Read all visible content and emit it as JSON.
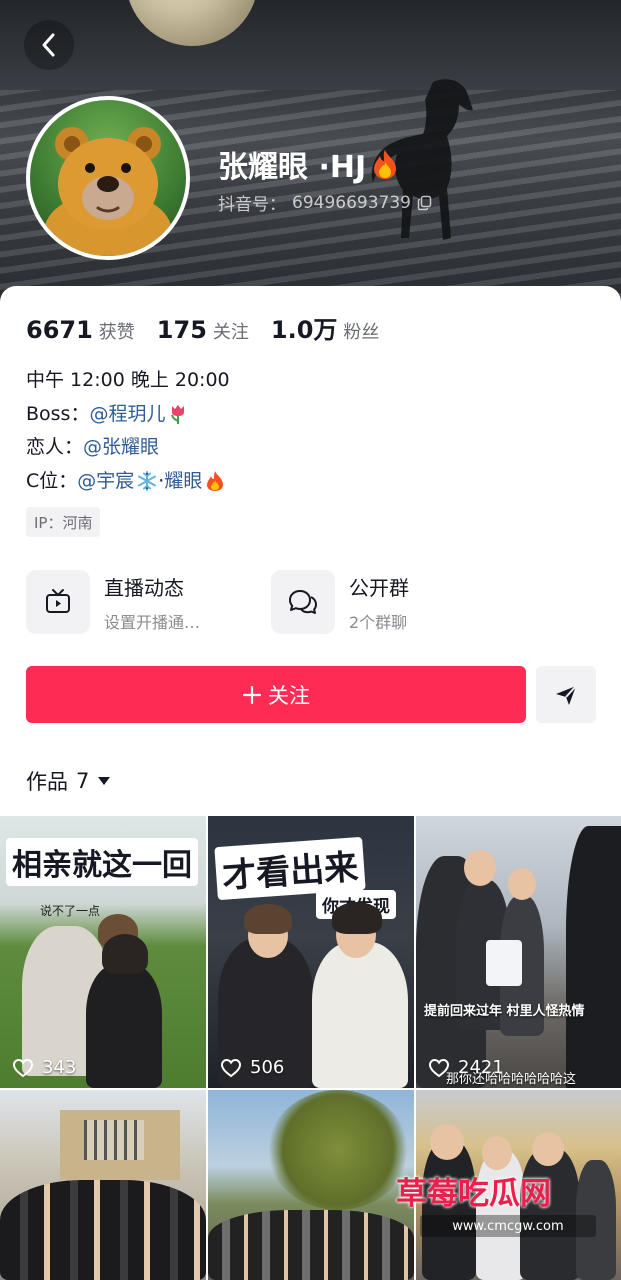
{
  "profile": {
    "nickname": "张耀眼 ·HJ",
    "douyin_id_label": "抖音号：",
    "douyin_id": "69496693739"
  },
  "stats": [
    {
      "value": "6671",
      "label": "获赞"
    },
    {
      "value": "175",
      "label": "关注"
    },
    {
      "value": "1.0万",
      "label": "粉丝"
    }
  ],
  "bio": {
    "line1": "中午 12:00 晚上 20:00",
    "line2_prefix": "Boss：",
    "line2_mention": "@程玥儿",
    "line3_prefix": "恋人：",
    "line3_mention": "@张耀眼",
    "line4_prefix": "C位：",
    "line4_mention": "@宇宸",
    "line4_sep": "·",
    "line4_mention2": "耀眼"
  },
  "ip_tag": "IP：河南",
  "features": [
    {
      "title": "直播动态",
      "subtitle": "设置开播通…",
      "icon": "tv-icon"
    },
    {
      "title": "公开群",
      "subtitle": "2个群聊",
      "icon": "group-chat-icon"
    }
  ],
  "follow_button": {
    "label": "关注"
  },
  "works_tab": {
    "label": "作品",
    "count": "7"
  },
  "videos": [
    {
      "likes": "343",
      "caption": "相亲就这一回",
      "subcaption": "说不了一点"
    },
    {
      "likes": "506",
      "caption": "才看出来",
      "subcaption": "你才发现"
    },
    {
      "likes": "2421",
      "caption": "提前回来过年 村里人怪热情",
      "subcaption": "那你还哈哈哈哈哈哈这"
    },
    {
      "likes": "",
      "caption": "",
      "subcaption": ""
    },
    {
      "likes": "",
      "caption": "",
      "subcaption": ""
    },
    {
      "likes": "",
      "caption": "",
      "subcaption": ""
    }
  ],
  "watermark": {
    "text": "草莓吃瓜网",
    "url": "www.cmcgw.com"
  },
  "colors": {
    "accent": "#fe2c55",
    "mention": "#2f5c97",
    "text": "#161823",
    "muted": "#6b6d75"
  }
}
